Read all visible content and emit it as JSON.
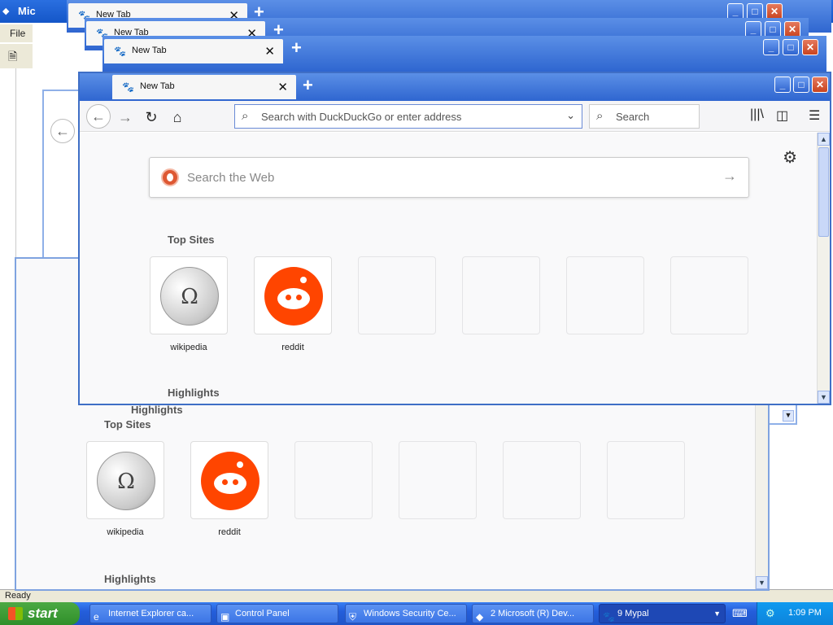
{
  "ie": {
    "title_partial": "Mic",
    "menu_file": "File",
    "status": "Ready"
  },
  "browser": {
    "tab_title": "New Tab",
    "url_placeholder": "Search with DuckDuckGo or enter address",
    "search_placeholder": "Search",
    "web_search_placeholder": "Search the Web",
    "top_sites_title": "Top Sites",
    "highlights_title": "Highlights",
    "sites": [
      {
        "label": "wikipedia"
      },
      {
        "label": "reddit"
      }
    ]
  },
  "taskbar": {
    "start_label": "start",
    "tasks": [
      {
        "label": "Internet Explorer ca...",
        "icon": "ie-icon"
      },
      {
        "label": "Control Panel",
        "icon": "control-panel-icon"
      },
      {
        "label": "Windows Security Ce...",
        "icon": "shield-icon"
      },
      {
        "label": "2 Microsoft (R) Dev...",
        "icon": "dev-icon"
      },
      {
        "label": "9 Mypal",
        "icon": "mypal-icon"
      }
    ],
    "clock": "1:09 PM"
  },
  "colors": {
    "titlebar": "#2f66d0",
    "reddit": "#ff4500",
    "ddg": "#de5833",
    "start": "#2f8f2a"
  }
}
